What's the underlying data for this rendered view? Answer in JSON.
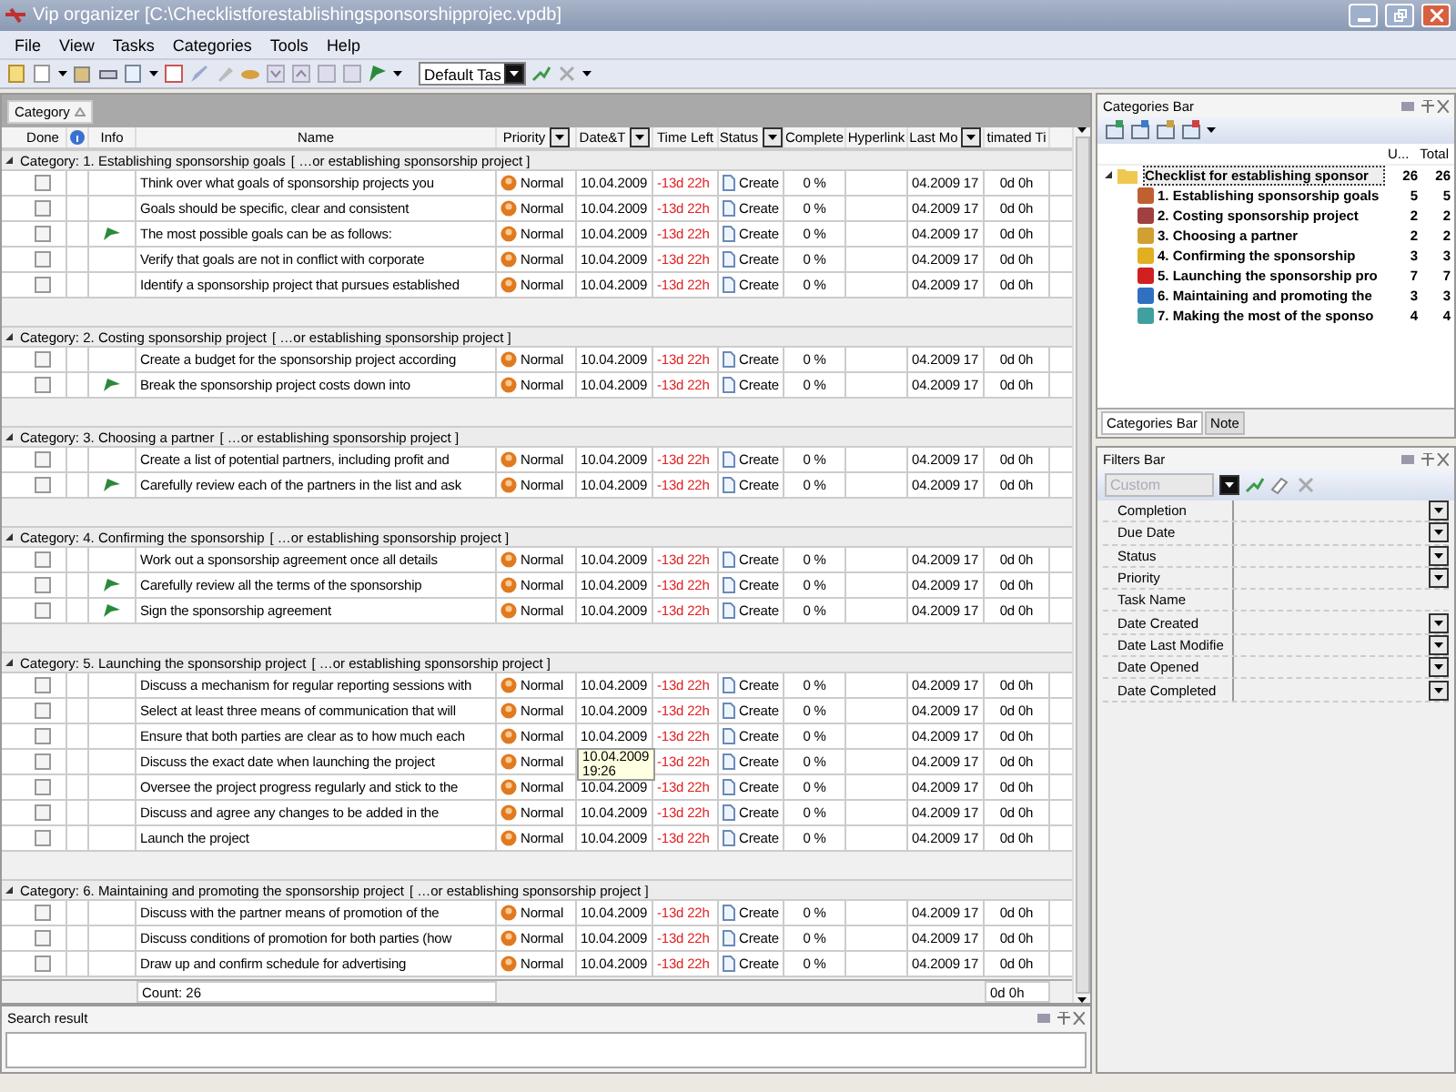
{
  "window": {
    "title": "Vip organizer [C:\\Checklistforestablishingsponsorshipprojec.vpdb]"
  },
  "menu": [
    "File",
    "View",
    "Tasks",
    "Categories",
    "Tools",
    "Help"
  ],
  "toolbar": {
    "view_select": "Default Tas"
  },
  "grouping": {
    "chip": "Category"
  },
  "columns": [
    {
      "kind": "text",
      "label": "Done",
      "filter": false
    },
    {
      "kind": "icon",
      "filter": false
    },
    {
      "kind": "text",
      "label": "Info",
      "filter": false
    },
    {
      "kind": "text",
      "label": "Name",
      "filter": false
    },
    {
      "kind": "text",
      "label": "Priority",
      "filter": true
    },
    {
      "kind": "text",
      "label": "Date&T",
      "filter": true
    },
    {
      "kind": "text",
      "label": "Time Left",
      "filter": false
    },
    {
      "kind": "text",
      "label": "Status",
      "filter": true
    },
    {
      "kind": "text",
      "label": "Complete",
      "filter": false
    },
    {
      "kind": "text",
      "label": "Hyperlink",
      "filter": false
    },
    {
      "kind": "text",
      "label": "Last Mo",
      "filter": true
    },
    {
      "kind": "text",
      "label": "timated Ti",
      "filter": false
    }
  ],
  "groups": [
    {
      "label": "Category: 1. Establishing sponsorship goals",
      "path": "[ …or establishing sponsorship project ]",
      "expanded": true,
      "rows": [
        {
          "done": false,
          "info": false,
          "name": "Think over what goals of sponsorship projects you",
          "priority": "Normal",
          "date": "10.04.2009",
          "time_left": "-13d 22h",
          "status": "Create",
          "complete": "0 %",
          "last_modified": "04.2009 17",
          "estimated": "0d 0h"
        },
        {
          "done": false,
          "info": false,
          "name": "Goals should be specific, clear and consistent",
          "priority": "Normal",
          "date": "10.04.2009",
          "time_left": "-13d 22h",
          "status": "Create",
          "complete": "0 %",
          "last_modified": "04.2009 17",
          "estimated": "0d 0h"
        },
        {
          "done": false,
          "info": true,
          "name": "The most possible goals can be as follows:",
          "priority": "Normal",
          "date": "10.04.2009",
          "time_left": "-13d 22h",
          "status": "Create",
          "complete": "0 %",
          "last_modified": "04.2009 17",
          "estimated": "0d 0h"
        },
        {
          "done": false,
          "info": false,
          "name": "Verify that goals are not in conflict with corporate",
          "priority": "Normal",
          "date": "10.04.2009",
          "time_left": "-13d 22h",
          "status": "Create",
          "complete": "0 %",
          "last_modified": "04.2009 17",
          "estimated": "0d 0h"
        },
        {
          "done": false,
          "info": false,
          "name": "Identify a sponsorship project that pursues established",
          "priority": "Normal",
          "date": "10.04.2009",
          "time_left": "-13d 22h",
          "status": "Create",
          "complete": "0 %",
          "last_modified": "04.2009 17",
          "estimated": "0d 0h"
        }
      ]
    },
    {
      "label": "Category: 2. Costing sponsorship project",
      "path": "[ …or establishing sponsorship project ]",
      "expanded": true,
      "rows": [
        {
          "done": false,
          "info": false,
          "name": "Create a budget for the sponsorship project according",
          "priority": "Normal",
          "date": "10.04.2009",
          "time_left": "-13d 22h",
          "status": "Create",
          "complete": "0 %",
          "last_modified": "04.2009 17",
          "estimated": "0d 0h"
        },
        {
          "done": false,
          "info": true,
          "name": "Break the sponsorship project costs down into",
          "priority": "Normal",
          "date": "10.04.2009",
          "time_left": "-13d 22h",
          "status": "Create",
          "complete": "0 %",
          "last_modified": "04.2009 17",
          "estimated": "0d 0h"
        }
      ]
    },
    {
      "label": "Category: 3. Choosing a partner",
      "path": "[ …or establishing sponsorship project ]",
      "expanded": true,
      "rows": [
        {
          "done": false,
          "info": false,
          "name": "Create a list of potential partners, including profit and",
          "priority": "Normal",
          "date": "10.04.2009",
          "time_left": "-13d 22h",
          "status": "Create",
          "complete": "0 %",
          "last_modified": "04.2009 17",
          "estimated": "0d 0h"
        },
        {
          "done": false,
          "info": true,
          "name": "Carefully review each of the partners in the list and ask",
          "priority": "Normal",
          "date": "10.04.2009",
          "time_left": "-13d 22h",
          "status": "Create",
          "complete": "0 %",
          "last_modified": "04.2009 17",
          "estimated": "0d 0h"
        }
      ]
    },
    {
      "label": "Category: 4. Confirming the sponsorship",
      "path": "[ …or establishing sponsorship project ]",
      "expanded": true,
      "rows": [
        {
          "done": false,
          "info": false,
          "name": "Work out a sponsorship agreement once all details",
          "priority": "Normal",
          "date": "10.04.2009",
          "time_left": "-13d 22h",
          "status": "Create",
          "complete": "0 %",
          "last_modified": "04.2009 17",
          "estimated": "0d 0h"
        },
        {
          "done": false,
          "info": true,
          "name": "Carefully review all the terms of the sponsorship",
          "priority": "Normal",
          "date": "10.04.2009",
          "time_left": "-13d 22h",
          "status": "Create",
          "complete": "0 %",
          "last_modified": "04.2009 17",
          "estimated": "0d 0h"
        },
        {
          "done": false,
          "info": true,
          "name": "Sign the sponsorship agreement",
          "priority": "Normal",
          "date": "10.04.2009",
          "time_left": "-13d 22h",
          "status": "Create",
          "complete": "0 %",
          "last_modified": "04.2009 17",
          "estimated": "0d 0h"
        }
      ]
    },
    {
      "label": "Category: 5. Launching the sponsorship project",
      "path": "[ …or establishing sponsorship project ]",
      "expanded": true,
      "rows": [
        {
          "done": false,
          "info": false,
          "name": "Discuss a mechanism for regular reporting sessions with",
          "priority": "Normal",
          "date": "10.04.2009",
          "time_left": "-13d 22h",
          "status": "Create",
          "complete": "0 %",
          "last_modified": "04.2009 17",
          "estimated": "0d 0h"
        },
        {
          "done": false,
          "info": false,
          "name": "Select at least three means of communication that will",
          "priority": "Normal",
          "date": "10.04.2009",
          "time_left": "-13d 22h",
          "status": "Create",
          "complete": "0 %",
          "last_modified": "04.2009 17",
          "estimated": "0d 0h"
        },
        {
          "done": false,
          "info": false,
          "name": "Ensure that both parties are clear as to how much each",
          "priority": "Normal",
          "date": "10.04.2009",
          "time_left": "-13d 22h",
          "status": "Create",
          "complete": "0 %",
          "last_modified": "04.2009 17",
          "estimated": "0d 0h"
        },
        {
          "done": false,
          "info": false,
          "name": "Discuss the exact date when launching the project",
          "priority": "Normal",
          "date_tooltip": [
            "10.04.2009",
            "19:26"
          ],
          "time_left": "-13d 22h",
          "status": "Create",
          "complete": "0 %",
          "last_modified": "04.2009 17",
          "estimated": "0d 0h"
        },
        {
          "done": false,
          "info": false,
          "name": "Oversee the project progress regularly and stick to the",
          "priority": "Normal",
          "date": "10.04.2009",
          "time_left": "-13d 22h",
          "status": "Create",
          "complete": "0 %",
          "last_modified": "04.2009 17",
          "estimated": "0d 0h"
        },
        {
          "done": false,
          "info": false,
          "name": "Discuss and agree any changes to be added in the",
          "priority": "Normal",
          "date": "10.04.2009",
          "time_left": "-13d 22h",
          "status": "Create",
          "complete": "0 %",
          "last_modified": "04.2009 17",
          "estimated": "0d 0h"
        },
        {
          "done": false,
          "info": false,
          "name": "Launch the project",
          "priority": "Normal",
          "date": "10.04.2009",
          "time_left": "-13d 22h",
          "status": "Create",
          "complete": "0 %",
          "last_modified": "04.2009 17",
          "estimated": "0d 0h"
        }
      ]
    },
    {
      "label": "Category: 6. Maintaining and promoting the sponsorship project",
      "path": "[ …or establishing sponsorship project ]",
      "expanded": true,
      "rows": [
        {
          "done": false,
          "info": false,
          "name": "Discuss with the partner means of promotion of the",
          "priority": "Normal",
          "date": "10.04.2009",
          "time_left": "-13d 22h",
          "status": "Create",
          "complete": "0 %",
          "last_modified": "04.2009 17",
          "estimated": "0d 0h"
        },
        {
          "done": false,
          "info": false,
          "name": "Discuss conditions of promotion for both parties (how",
          "priority": "Normal",
          "date": "10.04.2009",
          "time_left": "-13d 22h",
          "status": "Create",
          "complete": "0 %",
          "last_modified": "04.2009 17",
          "estimated": "0d 0h"
        },
        {
          "done": false,
          "info": false,
          "name": "Draw up and confirm schedule for advertising",
          "priority": "Normal",
          "date": "10.04.2009",
          "time_left": "-13d 22h",
          "status": "Create",
          "complete": "0 %",
          "last_modified": "04.2009 17",
          "estimated": "0d 0h"
        }
      ]
    }
  ],
  "footer": {
    "count": "Count: 26",
    "estimated": "0d 0h"
  },
  "search_result": {
    "title": "Search result"
  },
  "categories_bar": {
    "title": "Categories Bar",
    "columns": [
      "U...",
      "Total"
    ],
    "tree": {
      "label": "Checklist for establishing sponsor",
      "unread": "26",
      "total": "26",
      "selected": true,
      "expanded": true,
      "children": [
        {
          "label": "1. Establishing sponsorship goals",
          "unread": "5",
          "total": "5",
          "color": "#c06030"
        },
        {
          "label": "2. Costing sponsorship project",
          "unread": "2",
          "total": "2",
          "color": "#a04040"
        },
        {
          "label": "3. Choosing a partner",
          "unread": "2",
          "total": "2",
          "color": "#d0a030"
        },
        {
          "label": "4. Confirming the sponsorship",
          "unread": "3",
          "total": "3",
          "color": "#e0b020"
        },
        {
          "label": "5. Launching the sponsorship pro",
          "unread": "7",
          "total": "7",
          "color": "#d02020"
        },
        {
          "label": "6. Maintaining and promoting the",
          "unread": "3",
          "total": "3",
          "color": "#3070c0"
        },
        {
          "label": "7. Making the most of the sponso",
          "unread": "4",
          "total": "4",
          "color": "#40a0a0"
        }
      ]
    },
    "tabs": [
      {
        "label": "Categories Bar",
        "selected": true
      },
      {
        "label": "Note",
        "selected": false
      }
    ]
  },
  "filters_bar": {
    "title": "Filters Bar",
    "preset": {
      "placeholder": "Custom",
      "disabled": true
    },
    "filters": [
      {
        "label": "Completion",
        "dropdown": true
      },
      {
        "label": "Due Date",
        "dropdown": true
      },
      {
        "label": "Status",
        "dropdown": true
      },
      {
        "label": "Priority",
        "dropdown": true
      },
      {
        "label": "Task Name",
        "dropdown": false
      },
      {
        "label": "Date Created",
        "dropdown": true
      },
      {
        "label": "Date Last Modifie",
        "dropdown": true
      },
      {
        "label": "Date Opened",
        "dropdown": true
      },
      {
        "label": "Date Completed",
        "dropdown": true
      }
    ]
  }
}
